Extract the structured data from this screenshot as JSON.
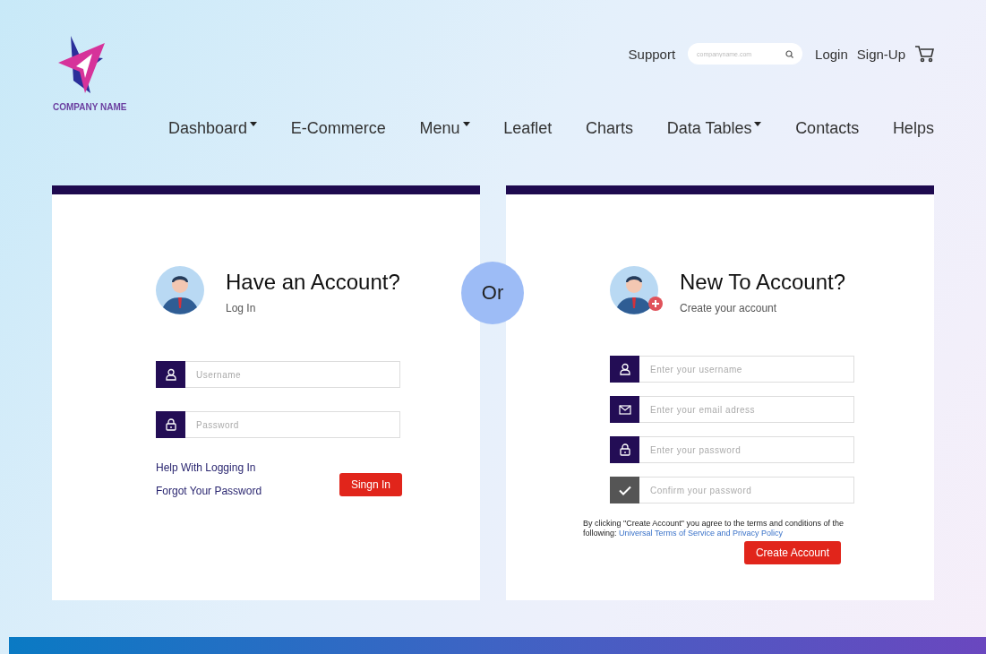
{
  "header": {
    "logo_text": "COMPANY NAME",
    "support": "Support",
    "search": {
      "placeholder": "companyname.com"
    },
    "login": "Login",
    "signup": "Sign-Up"
  },
  "nav": [
    {
      "label": "Dashboard",
      "has_caret": true
    },
    {
      "label": "E-Commerce",
      "has_caret": false
    },
    {
      "label": "Menu",
      "has_caret": true
    },
    {
      "label": "Leaflet",
      "has_caret": false
    },
    {
      "label": "Charts",
      "has_caret": false
    },
    {
      "label": "Data Tables",
      "has_caret": true
    },
    {
      "label": "Contacts",
      "has_caret": false
    },
    {
      "label": "Helps",
      "has_caret": false
    }
  ],
  "login_card": {
    "title": "Have an Account?",
    "subtitle": "Log In",
    "avatar_badge": false,
    "fields": [
      {
        "kind": "user",
        "placeholder": "Username"
      },
      {
        "kind": "lock",
        "placeholder": "Password"
      }
    ],
    "links": [
      "Help With Logging In",
      "Forgot Your Password"
    ],
    "button": "Singn In"
  },
  "or_label": "Or",
  "signup_card": {
    "title": "New To Account?",
    "subtitle": "Create your account",
    "avatar_badge": true,
    "fields": [
      {
        "kind": "user",
        "placeholder": "Enter your username"
      },
      {
        "kind": "mail",
        "placeholder": "Enter your email adress"
      },
      {
        "kind": "lock",
        "placeholder": "Enter your password"
      },
      {
        "kind": "check",
        "placeholder": "Confirm your password"
      }
    ],
    "terms": {
      "text": "By clicking \"Create Account\" you agree to the terms and conditions of the following:",
      "link": "Universal Terms of Service and Privacy Policy"
    },
    "button": "Create Account"
  }
}
